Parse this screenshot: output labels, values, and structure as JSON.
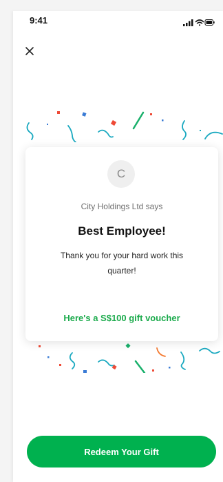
{
  "status_bar": {
    "time": "9:41",
    "icons": [
      "signal-icon",
      "wifi-icon",
      "battery-icon"
    ]
  },
  "header": {
    "close_icon": "close-icon"
  },
  "card": {
    "avatar_initial": "C",
    "sender": "City Holdings Ltd says",
    "title": "Best Employee!",
    "message": "Thank you for your hard work this quarter!",
    "voucher": "Here's a S$100 gift voucher"
  },
  "footer": {
    "redeem_label": "Redeem Your Gift"
  },
  "colors": {
    "primary": "#00b14f",
    "voucher_text": "#1aaa4b",
    "confetti": [
      "#1aa9c0",
      "#ee4a36",
      "#3a7bd5",
      "#f47a31",
      "#19b06b"
    ]
  }
}
